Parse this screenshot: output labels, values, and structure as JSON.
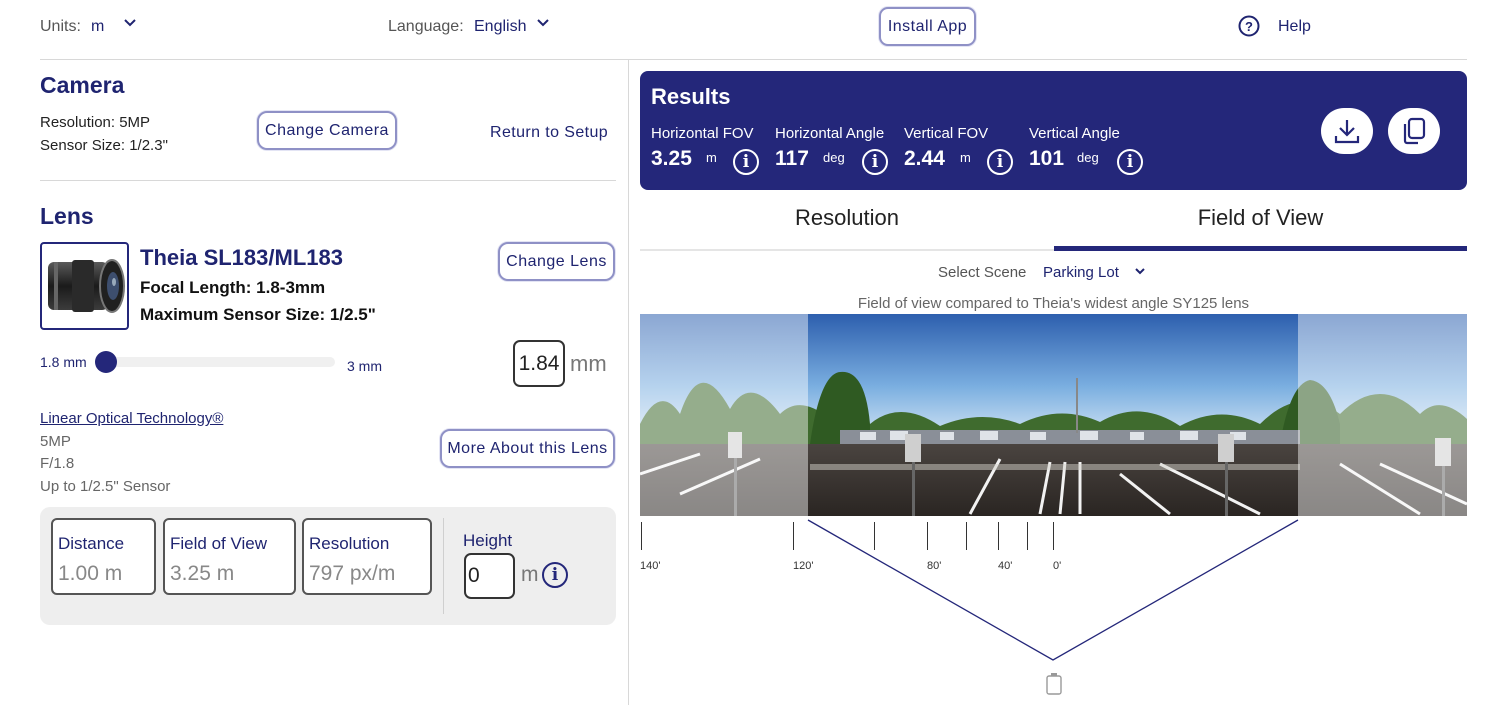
{
  "topbar": {
    "units_label": "Units:",
    "units_value": "m",
    "language_label": "Language:",
    "language_value": "English",
    "install_app": "Install App",
    "help": "Help"
  },
  "camera": {
    "heading": "Camera",
    "resolution": "Resolution: 5MP",
    "sensor_size": "Sensor Size: 1/2.3\"",
    "change_button": "Change Camera",
    "return_link": "Return to Setup"
  },
  "lens": {
    "heading": "Lens",
    "name": "Theia SL183/ML183",
    "focal_length": "Focal Length: 1.8-3mm",
    "max_sensor": "Maximum Sensor Size: 1/2.5\"",
    "change_button": "Change Lens",
    "slider_min": "1.8 mm",
    "slider_max": "3 mm",
    "slider_fraction": 0.0,
    "focal_value": "1.84",
    "focal_unit": "mm",
    "tech_link": "Linear Optical Technology®",
    "spec1": "5MP",
    "spec2": "F/1.8",
    "spec3": "Up to 1/2.5\" Sensor",
    "more_button": "More About this Lens"
  },
  "stats": {
    "distance_label": "Distance",
    "distance_value": "1.00 m",
    "fov_label": "Field of View",
    "fov_value": "3.25 m",
    "resolution_label": "Resolution",
    "resolution_value": "797 px/m",
    "height_label": "Height",
    "height_value": "0",
    "height_unit": "m"
  },
  "results": {
    "title": "Results",
    "hfov_label": "Horizontal FOV",
    "hfov_value": "3.25",
    "hfov_unit": "m",
    "hangle_label": "Horizontal Angle",
    "hangle_value": "117",
    "hangle_unit": "deg",
    "vfov_label": "Vertical FOV",
    "vfov_value": "2.44",
    "vfov_unit": "m",
    "vangle_label": "Vertical Angle",
    "vangle_value": "101",
    "vangle_unit": "deg"
  },
  "tabs": {
    "resolution": "Resolution",
    "fov": "Field of View",
    "active": "Field of View"
  },
  "scene": {
    "select_label": "Select Scene",
    "select_value": "Parking Lot",
    "caption": "Field of view compared to Theia's widest angle SY125 lens"
  },
  "ruler": {
    "labels": [
      "140'",
      "120'",
      "80'",
      "40'",
      "0'"
    ]
  },
  "colors": {
    "navy": "#24277a",
    "accent_border": "#8f91c6"
  }
}
